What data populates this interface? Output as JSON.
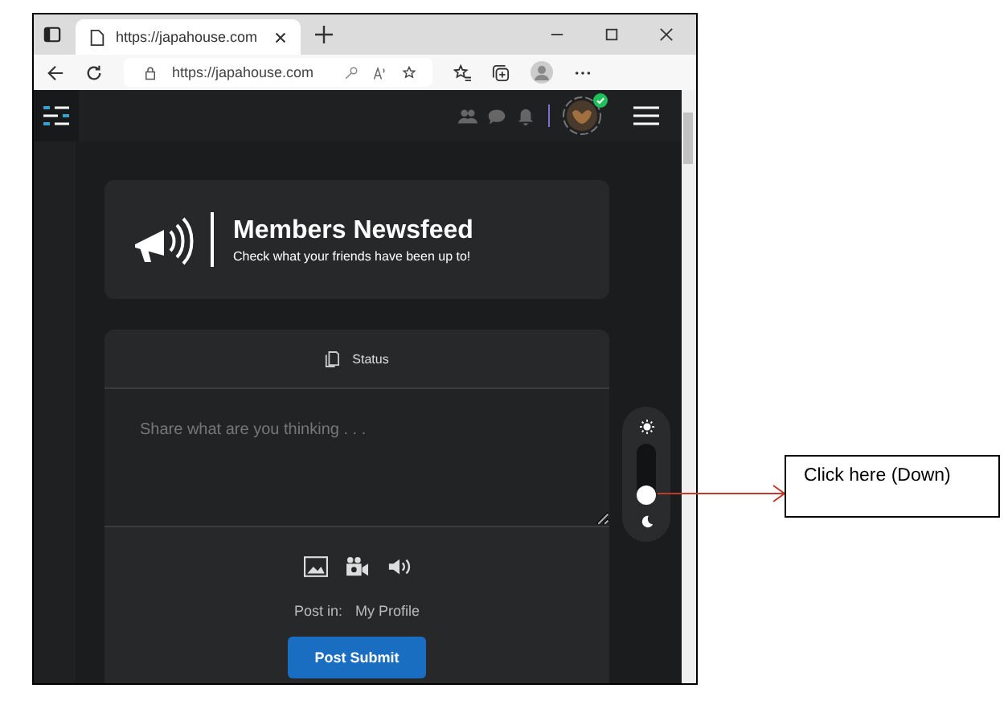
{
  "browser": {
    "tab_title": "https://japahouse.com",
    "address": "https://japahouse.com"
  },
  "banner": {
    "title": "Members Newsfeed",
    "subtitle": "Check what your friends have been up to!"
  },
  "composer": {
    "tab": "Status",
    "placeholder": "Share what are you thinking . . .",
    "post_in_label": "Post in:",
    "post_in_value": "My Profile",
    "submit": "Post Submit"
  },
  "theme_toggle": {
    "dark": true
  },
  "callout": {
    "text": "Click here (Down)"
  }
}
